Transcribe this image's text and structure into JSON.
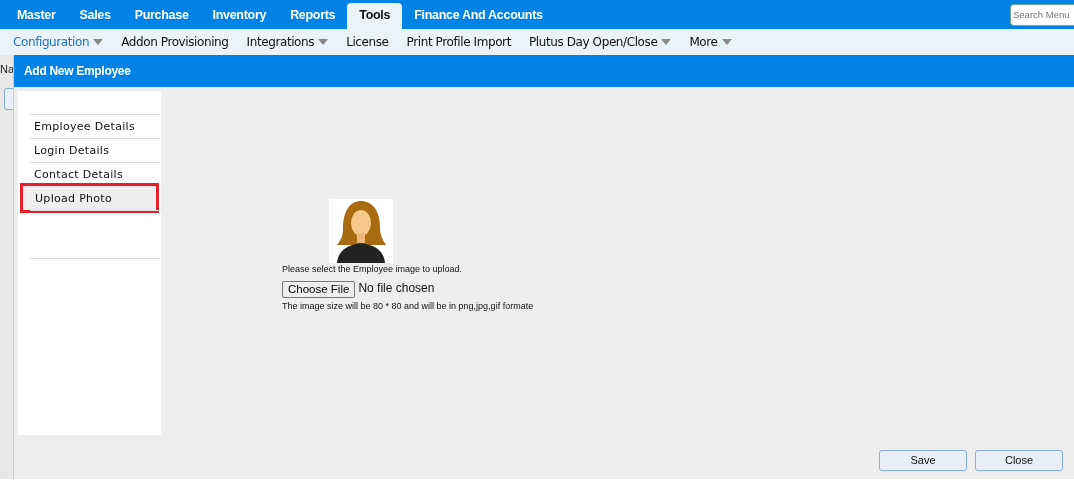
{
  "top_menu": [
    {
      "label": "Master",
      "selected": false
    },
    {
      "label": "Sales",
      "selected": false
    },
    {
      "label": "Purchase",
      "selected": false
    },
    {
      "label": "Inventory",
      "selected": false
    },
    {
      "label": "Reports",
      "selected": false
    },
    {
      "label": "Tools",
      "selected": true
    },
    {
      "label": "Finance And Accounts",
      "selected": false
    }
  ],
  "search": {
    "placeholder": "Search Menu"
  },
  "sub_menu": [
    {
      "label": "Configuration",
      "dropdown": true,
      "selected": true
    },
    {
      "label": "Addon Provisioning",
      "dropdown": false,
      "selected": false
    },
    {
      "label": "Integrations",
      "dropdown": true,
      "selected": false
    },
    {
      "label": "License",
      "dropdown": false,
      "selected": false
    },
    {
      "label": "Print Profile Import",
      "dropdown": false,
      "selected": false
    },
    {
      "label": "Plutus Day Open/Close",
      "dropdown": true,
      "selected": false
    },
    {
      "label": "More",
      "dropdown": true,
      "selected": false
    }
  ],
  "background": {
    "label": "Na"
  },
  "modal": {
    "title": "Add New Employee",
    "steps": [
      {
        "label": "Employee Details",
        "selected": false
      },
      {
        "label": "Login Details",
        "selected": false
      },
      {
        "label": "Contact Details",
        "selected": false
      },
      {
        "label": "Upload Photo",
        "selected": true
      }
    ],
    "upload": {
      "prompt": "Please select the Employee image to upload.",
      "button": "Choose File",
      "file_status": "No file chosen",
      "hint": "The image size will be 80 * 80 and will be in png,jpg,gif formate"
    },
    "buttons": [
      "Save",
      "Close"
    ]
  }
}
